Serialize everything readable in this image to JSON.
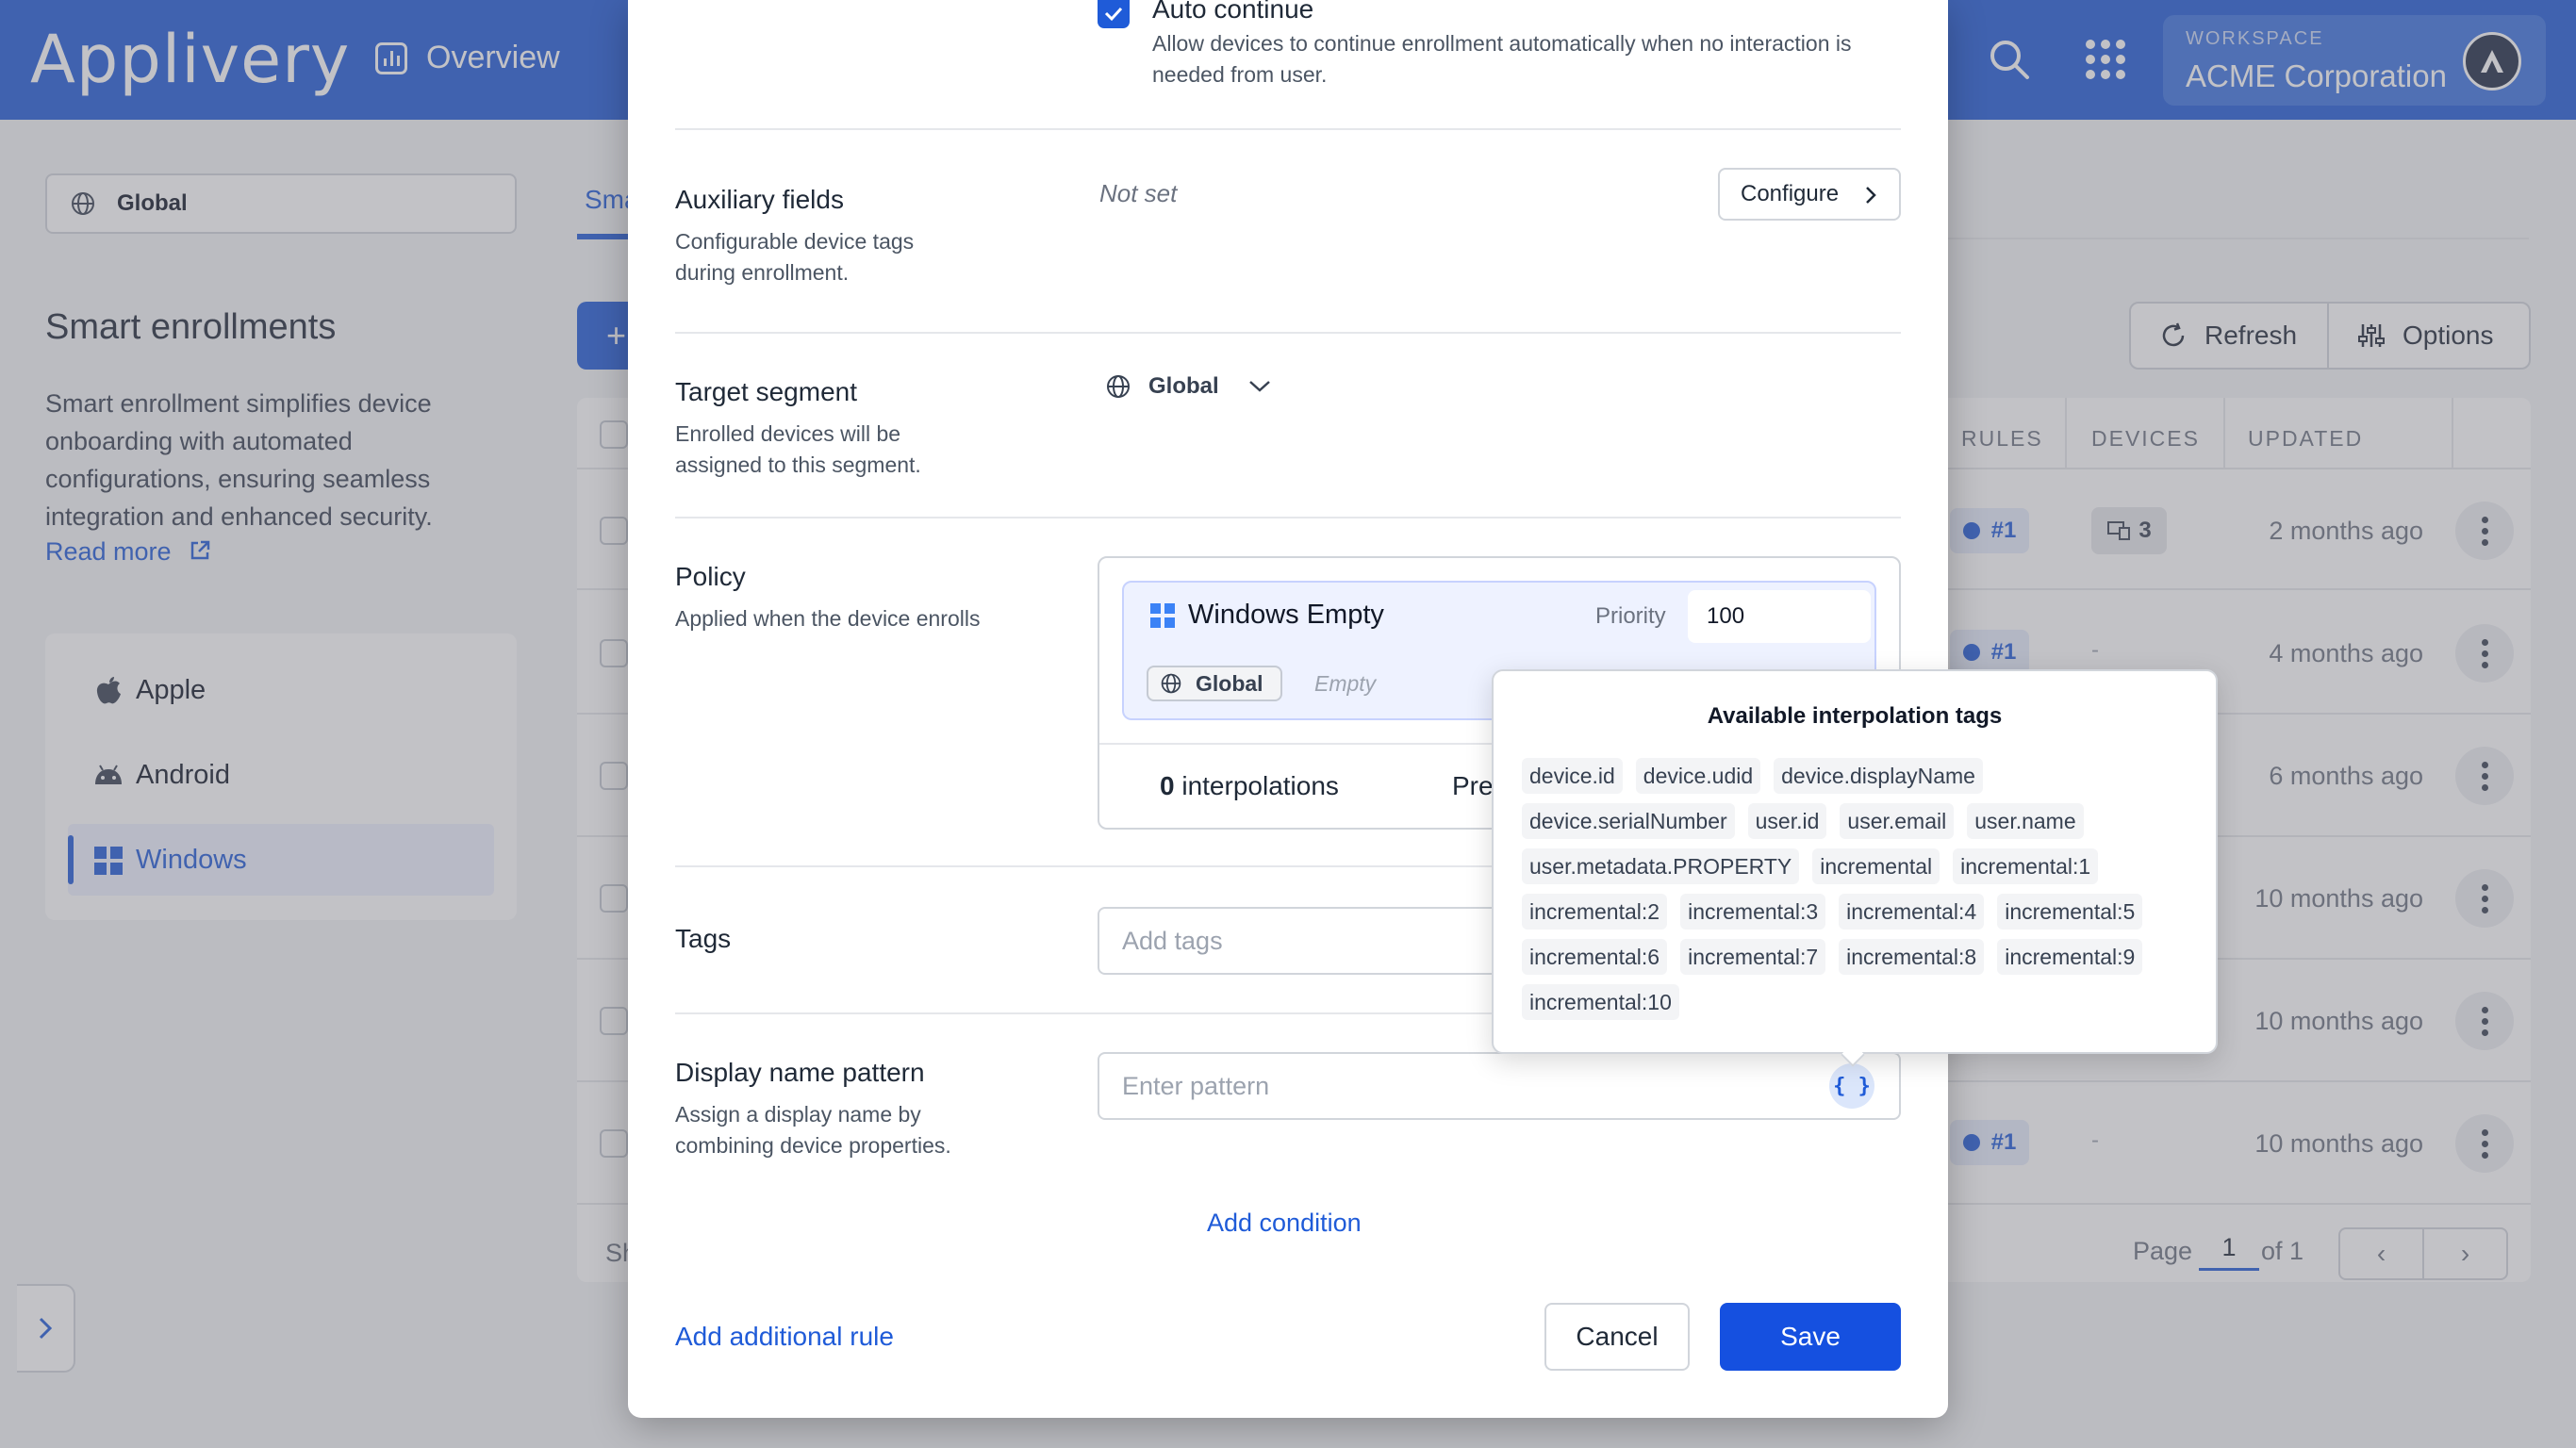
{
  "app": {
    "logo": "Applivery",
    "nav_overview": "Overview",
    "workspace_label": "WORKSPACE",
    "workspace_name": "ACME Corporation"
  },
  "sidebar": {
    "segment": "Global",
    "title": "Smart enrollments",
    "description": "Smart enrollment simplifies device onboarding with automated configurations, ensuring seamless integration and enhanced security.",
    "read_more": "Read more",
    "platforms": [
      {
        "label": "Apple",
        "icon": "apple-icon"
      },
      {
        "label": "Android",
        "icon": "android-icon"
      },
      {
        "label": "Windows",
        "icon": "windows-icon",
        "active": true
      }
    ]
  },
  "main": {
    "tab_partial": "Sma",
    "add_partial": "+",
    "refresh": "Refresh",
    "options": "Options",
    "columns": [
      "RULES",
      "DEVICES",
      "UPDATED"
    ],
    "rows": [
      {
        "rule": "#1",
        "devices": "3",
        "updated": "2 months ago"
      },
      {
        "rule": "#1",
        "devices": "-",
        "updated": "4 months ago"
      },
      {
        "rule": "",
        "devices": "",
        "updated": "6 months ago"
      },
      {
        "rule": "",
        "devices": "",
        "updated": "10 months ago"
      },
      {
        "rule": "",
        "devices": "",
        "updated": "10 months ago"
      },
      {
        "rule": "#1",
        "devices": "-",
        "updated": "10 months ago"
      }
    ],
    "footer_partial": "Sh",
    "pager": {
      "page_label": "Page",
      "page": "1",
      "of": "of 1"
    }
  },
  "modal": {
    "auto_continue": {
      "title": "Auto continue",
      "description": "Allow devices to continue enrollment automatically when no interaction is needed from user.",
      "checked": true
    },
    "auxiliary": {
      "title": "Auxiliary fields",
      "description": "Configurable device tags during enrollment.",
      "value": "Not set",
      "button": "Configure"
    },
    "target_segment": {
      "title": "Target segment",
      "description": "Enrolled devices will be assigned to this segment.",
      "value": "Global"
    },
    "policy": {
      "title": "Policy",
      "description": "Applied when the device enrolls",
      "name": "Windows Empty",
      "priority_label": "Priority",
      "priority": "100",
      "segment_chip": "Global",
      "empty": "Empty",
      "interpolations_count": "0",
      "interpolations_label": "interpolations",
      "pre_partial": "Pre"
    },
    "tags": {
      "title": "Tags",
      "placeholder": "Add tags"
    },
    "display_name": {
      "title": "Display name pattern",
      "description": "Assign a display name by combining device properties.",
      "placeholder": "Enter pattern",
      "brace": "{ }"
    },
    "add_condition": "Add condition",
    "add_rule": "Add additional rule",
    "cancel": "Cancel",
    "save": "Save"
  },
  "popover": {
    "title": "Available interpolation tags",
    "tags": [
      "device.id",
      "device.udid",
      "device.displayName",
      "device.serialNumber",
      "user.id",
      "user.email",
      "user.name",
      "user.metadata.PROPERTY",
      "incremental",
      "incremental:1",
      "incremental:2",
      "incremental:3",
      "incremental:4",
      "incremental:5",
      "incremental:6",
      "incremental:7",
      "incremental:8",
      "incremental:9",
      "incremental:10"
    ]
  },
  "colors": {
    "primary": "#1f5bd8",
    "save": "#1550e0"
  }
}
